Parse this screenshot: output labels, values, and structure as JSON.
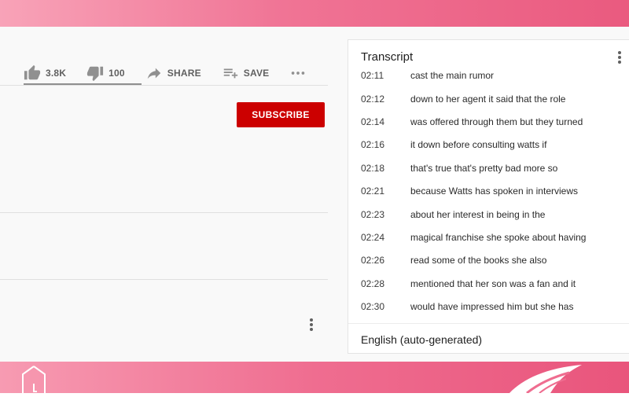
{
  "actions": {
    "like_count": "3.8K",
    "dislike_count": "100",
    "share_label": "SHARE",
    "save_label": "SAVE"
  },
  "channel": {
    "subscribe_label": "SUBSCRIBE"
  },
  "transcript": {
    "title": "Transcript",
    "language": "English (auto-generated)",
    "lines": [
      {
        "time": "02:11",
        "text": "cast the main rumor"
      },
      {
        "time": "02:12",
        "text": "down to her agent it said that the role"
      },
      {
        "time": "02:14",
        "text": "was offered through them but they turned"
      },
      {
        "time": "02:16",
        "text": "it down before consulting watts if"
      },
      {
        "time": "02:18",
        "text": "that's true that's pretty bad more so"
      },
      {
        "time": "02:21",
        "text": "because Watts has spoken in interviews"
      },
      {
        "time": "02:23",
        "text": "about her interest in being in the"
      },
      {
        "time": "02:24",
        "text": "magical franchise she spoke about having"
      },
      {
        "time": "02:26",
        "text": "read some of the books she also"
      },
      {
        "time": "02:28",
        "text": "mentioned that her son was a fan and it"
      },
      {
        "time": "02:30",
        "text": "would have impressed him but she has"
      }
    ]
  },
  "colors": {
    "accent": "#cc0000",
    "band_pink": "#ef6d90"
  },
  "icons": {
    "like": "thumbs-up-icon",
    "dislike": "thumbs-down-icon",
    "share": "share-arrow-icon",
    "save": "playlist-add-icon",
    "more": "more-vertical-icon"
  }
}
